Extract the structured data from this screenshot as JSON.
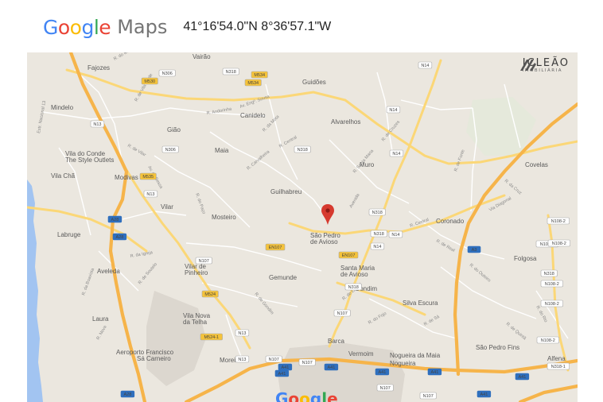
{
  "header": {
    "logo_letters": [
      "G",
      "o",
      "o",
      "g",
      "l",
      "e"
    ],
    "logo_colors": [
      "#4285F4",
      "#EA4335",
      "#FBBC05",
      "#4285F4",
      "#34A853",
      "#EA4335"
    ],
    "product": "Maps",
    "coordinates": "41°16'54.0\"N 8°36'57.1\"W"
  },
  "map": {
    "colors": {
      "land": "#ebe7df",
      "water": "#a2c4f1",
      "highway": "#f6b44a",
      "major_road": "#fbd777",
      "minor_road": "#ffffff",
      "urban": "#dcd7cf",
      "park": "#d4e4c4",
      "marker": "#d63a2f"
    },
    "marker_icon": "map-pin-icon",
    "places": [
      "Vairão",
      "Fajozes",
      "Guidões",
      "Mindelo",
      "Canidelo",
      "Gião",
      "Alvarelhos",
      "Maia",
      "Vila do Conde",
      "The Style Outlets",
      "Muro",
      "Covelas",
      "Vila Chã",
      "Modivas",
      "Guilhabreu",
      "Vilar",
      "Mosteiro",
      "Coronado",
      "Labruge",
      "São Pedro",
      "de Avioso",
      "Folgosa",
      "Aveleda",
      "Vilar de",
      "Pinheiro",
      "Gemunde",
      "Santa Maria",
      "de Avioso",
      "Gondim",
      "Silva Escura",
      "Vila Nova",
      "da Telha",
      "Laura",
      "Barca",
      "Aeroporto Francisco",
      "Sá Carneiro",
      "Moreira",
      "Vermoim",
      "Nogueira da Maia",
      "São Pedro Fins",
      "Nogueira",
      "Alfena"
    ],
    "road_shields": [
      "N306",
      "N318",
      "M534",
      "M530",
      "M534",
      "N13",
      "N318",
      "N306",
      "M535",
      "N13",
      "N14",
      "N14",
      "N14",
      "A28",
      "EN107",
      "A28",
      "A3",
      "N318",
      "N318",
      "M524",
      "EN107",
      "N107",
      "N107",
      "N13",
      "N107",
      "N107",
      "A41",
      "A41",
      "N13",
      "N107",
      "N107",
      "A41",
      "N108-1",
      "N318",
      "N108-2",
      "N318",
      "N108-2",
      "N108-2",
      "A41",
      "A28",
      "N108-2",
      "A41",
      "M524-1",
      "A41",
      "A41",
      "N14",
      "N14",
      "N108-2",
      "N318-1"
    ],
    "streets": [
      "R. do Mirante",
      "R. de Vila Verde",
      "R. Andorinha",
      "Av. Engº. Sousa",
      "R. da Mota",
      "Estr. Nacional 13",
      "R. de Vilar",
      "R. Central",
      "R. de Cruzes",
      "Av. de Bessa",
      "R. Carvalheira",
      "R. do Paço",
      "Avenida",
      "R. Santa Maria",
      "R. de Fonte",
      "R. da Cruz",
      "Via Diagonal",
      "R. Central",
      "R. da Igreja",
      "R. de Real",
      "R. do Outeiro",
      "R. de Gondim",
      "R. de Cidnai",
      "R. do Rio",
      "R. de Soutelo",
      "R. da Boavista",
      "R. do Fojo",
      "R. de Sá",
      "R. de Quintã",
      "R. Nova"
    ],
    "pois": [
      "Vila do Conde",
      "The Style Outlets",
      "Nogueira da Maia"
    ],
    "brand": {
      "name": "JCLEÃO",
      "subtitle": "IMOBILIÁRIA"
    },
    "watermark_letters": [
      "G",
      "o",
      "o",
      "g",
      "l",
      "e"
    ],
    "watermark_colors": [
      "#4285F4",
      "#EA4335",
      "#FBBC05",
      "#4285F4",
      "#34A853",
      "#EA4335"
    ]
  }
}
